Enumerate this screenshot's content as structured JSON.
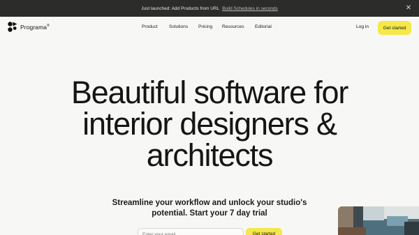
{
  "announcement": {
    "text": "Just launched: Add Products from URL",
    "link": "Build Schedules in seconds",
    "close_icon": "close-icon"
  },
  "nav": {
    "logo_text": "Programa",
    "logo_mark": "®",
    "items": [
      "Product",
      "Solutions",
      "Pricing",
      "Resources",
      "Editorial"
    ],
    "login": "Log in",
    "cta": "Get started"
  },
  "hero": {
    "title_lines": [
      "Beautiful software for",
      "interior designers &",
      "architects"
    ],
    "subtitle_lines": [
      "Streamline your workflow and unlock your studio's",
      "potential. Start your 7 day trial"
    ],
    "email_placeholder": "Enter your email",
    "start_button": "Get started"
  },
  "colors": {
    "announcement_bg": "#2c2c2a",
    "page_bg": "#f7f7f5",
    "accent_yellow": "#f4e84a"
  }
}
